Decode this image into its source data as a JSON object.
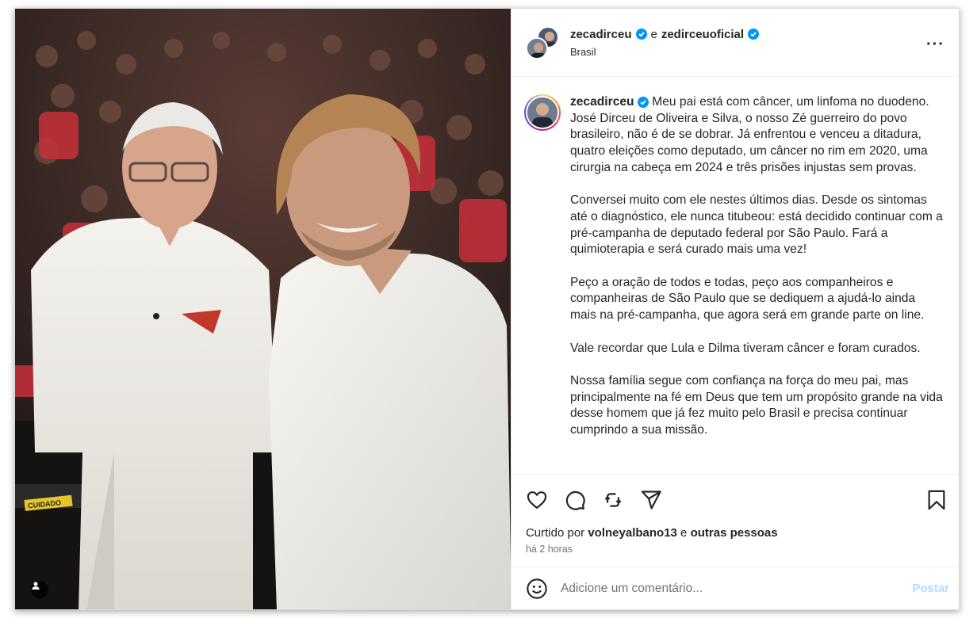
{
  "post": {
    "author_primary": "zecadirceu",
    "conjunction": "e",
    "author_secondary": "zedirceuoficial",
    "location": "Brasil",
    "more_icon": "more-horizontal-icon"
  },
  "photo": {
    "sign_text": "CUIDADO"
  },
  "caption": {
    "username": "zecadirceu",
    "paragraphs": [
      "Meu pai está com câncer, um linfoma no duodeno. José Dirceu de Oliveira e Silva, o nosso Zé guerreiro do povo brasileiro, não é de se dobrar. Já enfrentou e venceu a ditadura, quatro eleições como deputado, um câncer no rim em 2020, uma cirurgia na cabeça em 2024 e três prisões injustas sem provas.",
      "Conversei muito com ele nestes últimos dias. Desde os sintomas até o diagnóstico, ele nunca titubeou: está decidido continuar com a pré-campanha de deputado federal por São Paulo. Fará a quimioterapia e será curado mais uma vez!",
      "Peço a oração de todos e todas, peço aos companheiros e companheiras de São Paulo que se dediquem a ajudá-lo ainda mais na pré-campanha, que agora será em grande parte on line.",
      "Vale recordar que Lula e Dilma tiveram câncer e foram curados.",
      "Nossa família segue com confiança na força do meu pai, mas principalmente na fé em Deus que tem um propósito grande na vida desse homem que já fez muito pelo Brasil e precisa continuar cumprindo a sua missão."
    ]
  },
  "engagement": {
    "liked_prefix": "Curtido por",
    "liked_user": "volneyalbano13",
    "liked_and": "e",
    "liked_others": "outras pessoas",
    "time_ago": "há 2 horas"
  },
  "comment": {
    "placeholder": "Adicione um comentário...",
    "post_label": "Postar"
  },
  "colors": {
    "verified": "#0095f6",
    "post_button_disabled": "#b3dbff"
  }
}
